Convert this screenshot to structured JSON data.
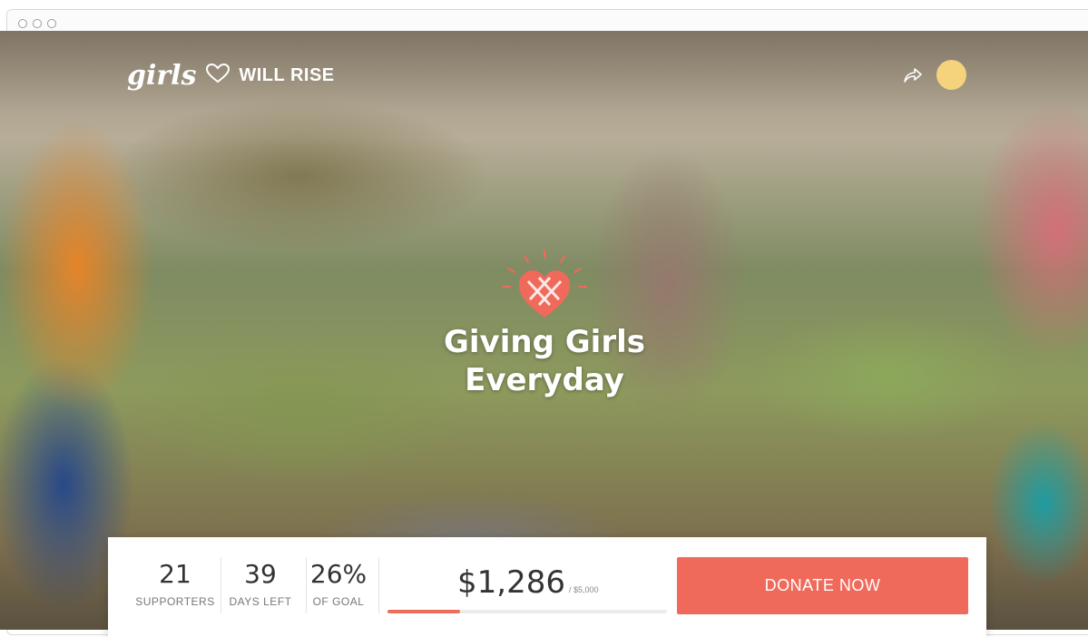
{
  "brand": {
    "logo_script": "girls",
    "logo_text": "WILL RISE"
  },
  "hero": {
    "headline_line1": "Giving Girls",
    "headline_line2": "Everyday"
  },
  "stats": {
    "supporters_value": "21",
    "supporters_label": "SUPPORTERS",
    "days_value": "39",
    "days_label": "DAYS LEFT",
    "goal_value": "26%",
    "goal_label": "OF GOAL"
  },
  "funding": {
    "raised": "$1,286",
    "goal": "/ $5,000",
    "progress_fraction": 0.26
  },
  "cta": {
    "donate_label": "DONATE NOW"
  },
  "colors": {
    "accent": "#f06a5b",
    "avatar": "#f4d37c"
  },
  "icons": [
    "heart-outline-icon",
    "share-icon",
    "heart-logo-icon"
  ]
}
